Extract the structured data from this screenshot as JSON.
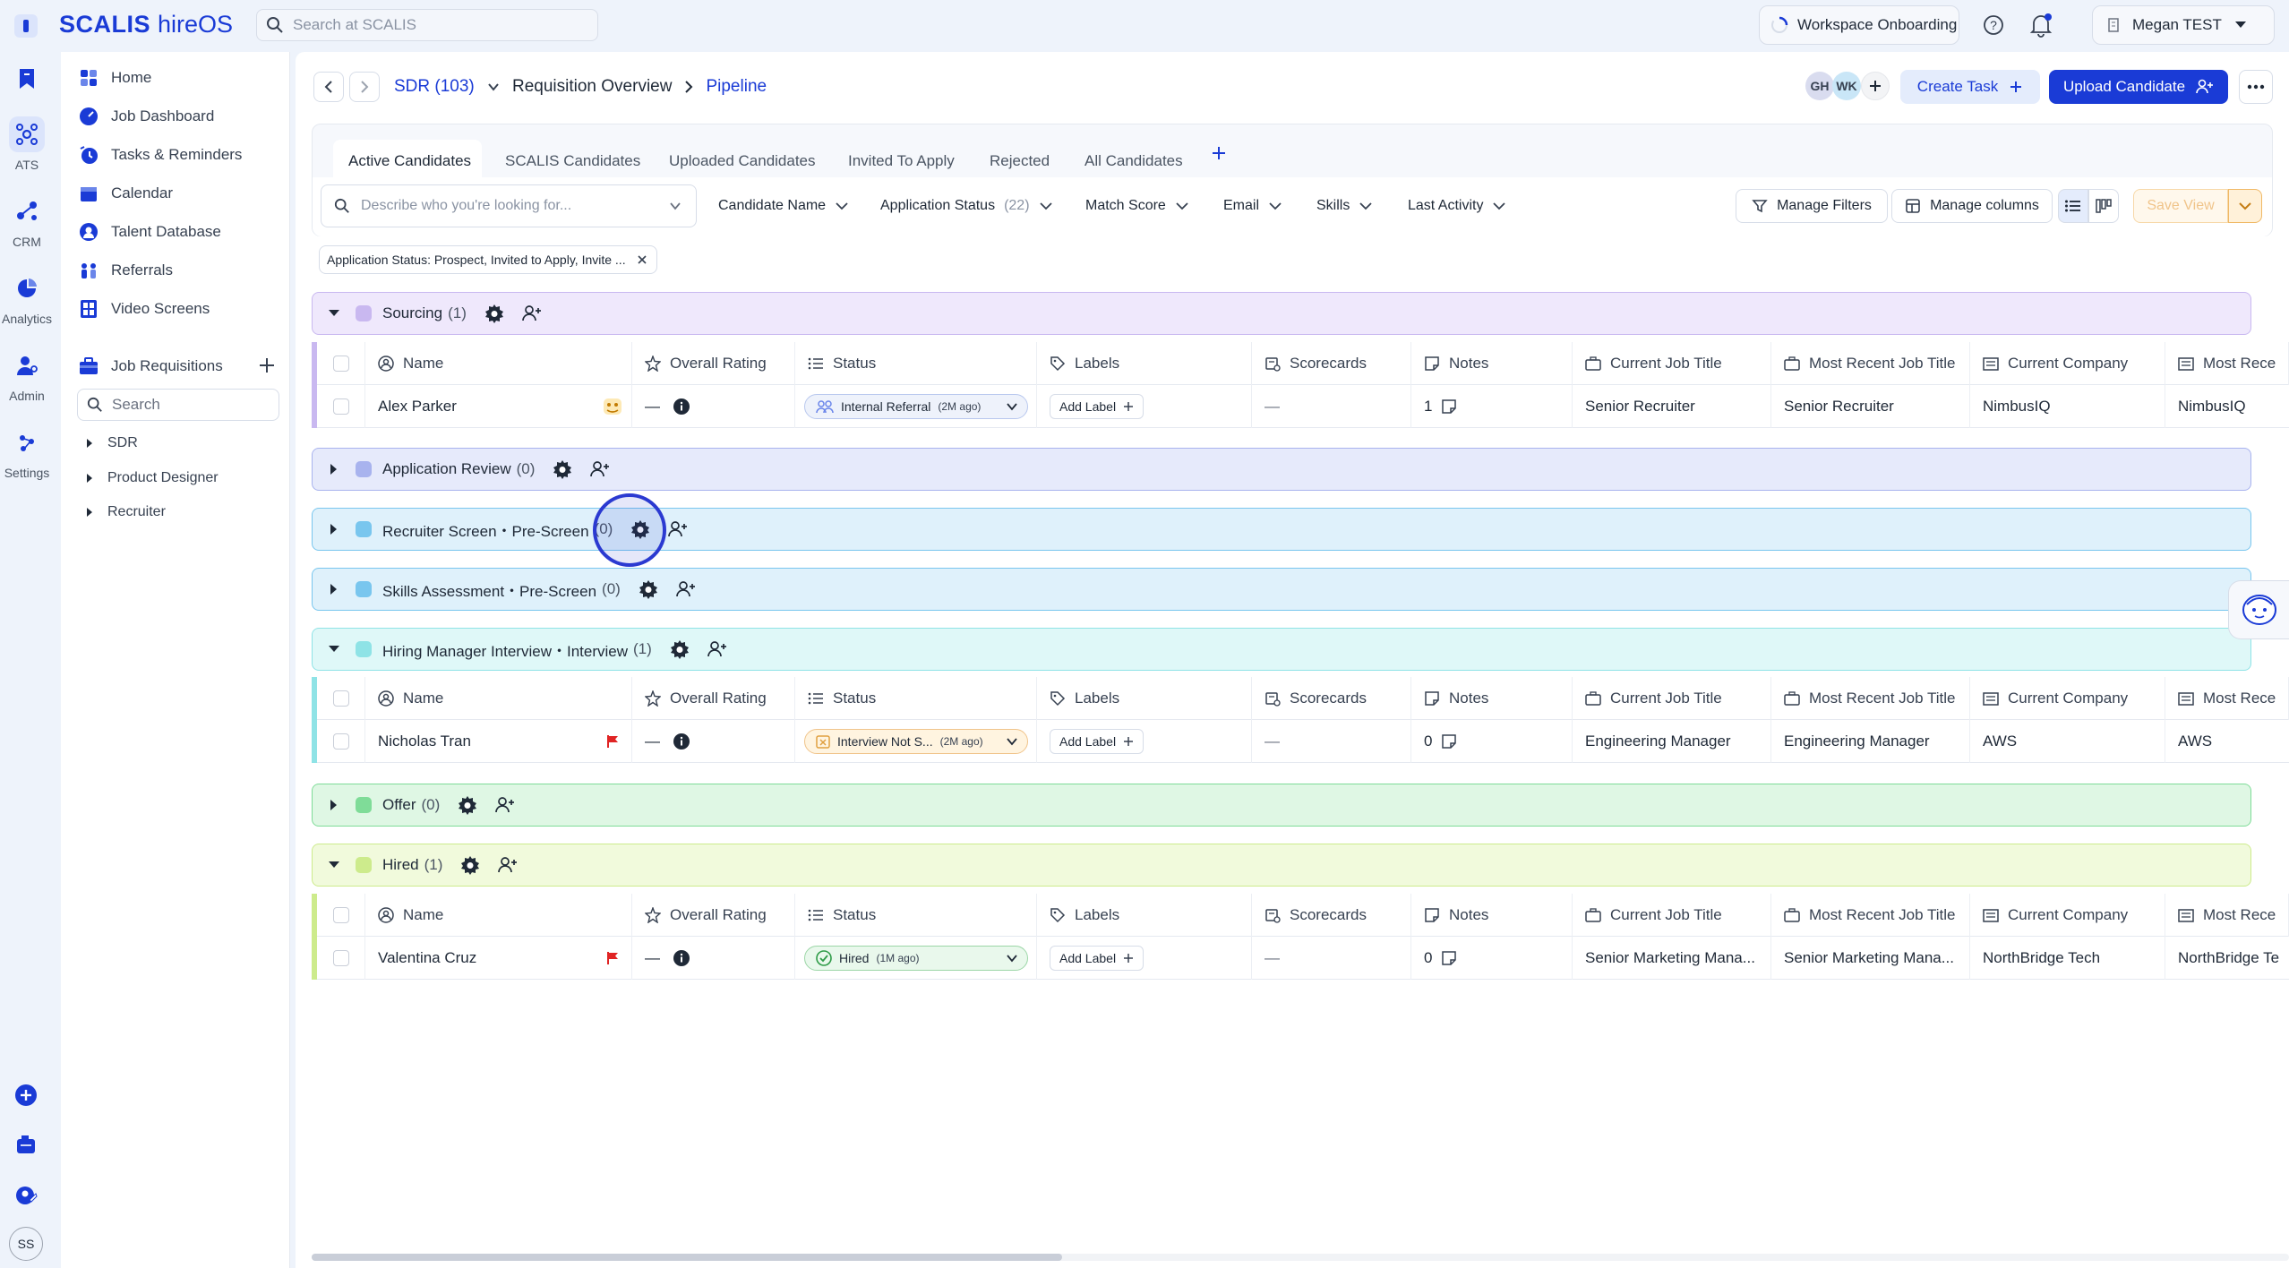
{
  "app": {
    "brand": "SCALIS",
    "product": "hireOS",
    "brand_color": "#1a3bd6"
  },
  "search": {
    "placeholder": "Search at SCALIS"
  },
  "topbar": {
    "onboarding_label": "Workspace Onboarding",
    "user_name": "Megan TEST"
  },
  "rail": {
    "items": [
      {
        "label": "",
        "icon": "bookmark-icon"
      },
      {
        "label": "ATS",
        "icon": "ats-icon"
      },
      {
        "label": "CRM",
        "icon": "crm-icon"
      },
      {
        "label": "Analytics",
        "icon": "analytics-icon"
      },
      {
        "label": "Admin",
        "icon": "admin-icon"
      },
      {
        "label": "Settings",
        "icon": "settings-icon"
      }
    ],
    "user_initials": "SS"
  },
  "sidebar": {
    "items": [
      {
        "label": "Home"
      },
      {
        "label": "Job Dashboard"
      },
      {
        "label": "Tasks & Reminders"
      },
      {
        "label": "Calendar"
      },
      {
        "label": "Talent Database"
      },
      {
        "label": "Referrals"
      },
      {
        "label": "Video Screens"
      }
    ],
    "job_requisitions_label": "Job Requisitions",
    "search_placeholder": "Search",
    "requisitions": [
      "SDR",
      "Product Designer",
      "Recruiter"
    ]
  },
  "header": {
    "job": "SDR (103)",
    "crumb1": "Requisition Overview",
    "crumb2": "Pipeline",
    "avatars": [
      "GH",
      "WK"
    ],
    "create_task": "Create Task",
    "upload_candidate": "Upload Candidate"
  },
  "tabs": [
    "Active Candidates",
    "SCALIS Candidates",
    "Uploaded Candidates",
    "Invited To Apply",
    "Rejected",
    "All Candidates"
  ],
  "filters": {
    "describe_placeholder": "Describe who you're looking for...",
    "candidate_name": "Candidate Name",
    "application_status": "Application Status",
    "application_status_count": "(22)",
    "match_score": "Match Score",
    "email": "Email",
    "skills": "Skills",
    "last_activity": "Last Activity",
    "manage_filters": "Manage Filters",
    "manage_columns": "Manage columns",
    "save_view": "Save View",
    "chip": "Application Status: Prospect, Invited to Apply, Invite ..."
  },
  "columns": [
    "Name",
    "Overall Rating",
    "Status",
    "Labels",
    "Scorecards",
    "Notes",
    "Current Job Title",
    "Most Recent Job Title",
    "Current Company",
    "Most Rece"
  ],
  "stages": [
    {
      "name": "Sourcing",
      "count": "(1)",
      "color": "#c9b8f0",
      "bg": "#efe8fc"
    },
    {
      "name": "Application Review",
      "count": "(0)",
      "color": "#a8b3ee",
      "bg": "#e6eafb"
    },
    {
      "name": "Recruiter Screen・Pre-Screen",
      "count": "(0)",
      "color": "#79c6ee",
      "bg": "#dff1fb"
    },
    {
      "name": "Skills Assessment・Pre-Screen",
      "count": "(0)",
      "color": "#79c6ee",
      "bg": "#dff1fb"
    },
    {
      "name": "Hiring Manager Interview・Interview",
      "count": "(1)",
      "color": "#8fe3e6",
      "bg": "#dff8f8"
    },
    {
      "name": "Offer",
      "count": "(0)",
      "color": "#7fdc98",
      "bg": "#dff7e4"
    },
    {
      "name": "Hired",
      "count": "(1)",
      "color": "#cdeb8c",
      "bg": "#f1fadc"
    }
  ],
  "candidates": [
    {
      "name": "Alex Parker",
      "rating": "—",
      "status": "Internal Referral",
      "status_ago": "(2M ago)",
      "label": "Add Label",
      "scorecards": "—",
      "notes": "1",
      "current_title": "Senior Recruiter",
      "recent_title": "Senior Recruiter",
      "company": "NimbusIQ",
      "recent_company": "NimbusIQ"
    },
    {
      "name": "Nicholas Tran",
      "rating": "—",
      "status": "Interview Not S...",
      "status_ago": "(2M ago)",
      "label": "Add Label",
      "scorecards": "—",
      "notes": "0",
      "current_title": "Engineering Manager",
      "recent_title": "Engineering Manager",
      "company": "AWS",
      "recent_company": "AWS"
    },
    {
      "name": "Valentina Cruz",
      "rating": "—",
      "status": "Hired",
      "status_ago": "(1M ago)",
      "label": "Add Label",
      "scorecards": "—",
      "notes": "0",
      "current_title": "Senior Marketing Mana...",
      "recent_title": "Senior Marketing Mana...",
      "company": "NorthBridge Tech",
      "recent_company": "NorthBridge Te"
    }
  ]
}
